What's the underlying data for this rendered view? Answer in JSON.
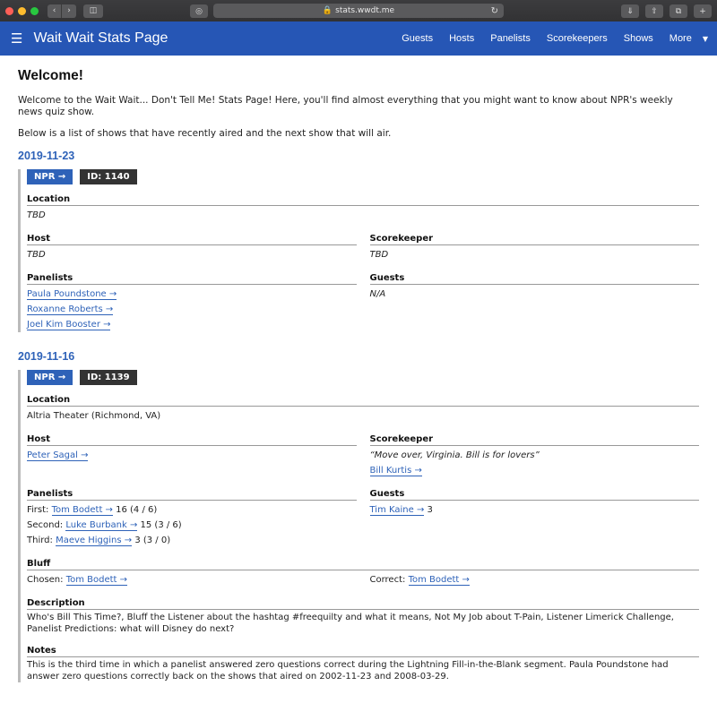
{
  "browser": {
    "url": "stats.wwdt.me"
  },
  "nav": {
    "brand": "Wait Wait Stats Page",
    "links": [
      "Guests",
      "Hosts",
      "Panelists",
      "Scorekeepers",
      "Shows",
      "More"
    ]
  },
  "page": {
    "title": "Welcome!",
    "intro1": "Welcome to the Wait Wait... Don't Tell Me! Stats Page! Here, you'll find almost everything that you might want to know about NPR's weekly news quiz show.",
    "intro2": "Below is a list of shows that have recently aired and the next show that will air."
  },
  "labels": {
    "location": "Location",
    "host": "Host",
    "scorekeeper": "Scorekeeper",
    "panelists": "Panelists",
    "guests": "Guests",
    "bluff": "Bluff",
    "description": "Description",
    "notes": "Notes",
    "chosen": "Chosen:",
    "correct": "Correct:",
    "first": "First:",
    "second": "Second:",
    "third": "Third:"
  },
  "show1": {
    "date": "2019-11-23",
    "npr": "NPR →",
    "id": "ID: 1140",
    "location": "TBD",
    "host": "TBD",
    "scorekeeper": "TBD",
    "panelists": [
      "Paula Poundstone →",
      "Roxanne Roberts →",
      "Joel Kim Booster →"
    ],
    "guests": "N/A"
  },
  "show2": {
    "date": "2019-11-16",
    "npr": "NPR →",
    "id": "ID: 1139",
    "location": "Altria Theater (Richmond, VA)",
    "host": "Peter Sagal →",
    "scorekeeper_quote": "“Move over, Virginia. Bill is for lovers”",
    "scorekeeper": "Bill Kurtis →",
    "panelists": [
      {
        "name": "Tom Bodett →",
        "score": "16 (4 / 6)"
      },
      {
        "name": "Luke Burbank →",
        "score": "15 (3 / 6)"
      },
      {
        "name": "Maeve Higgins →",
        "score": "3 (3 / 0)"
      }
    ],
    "guest": "Tim Kaine →",
    "guest_score": "3",
    "bluff_chosen": "Tom Bodett →",
    "bluff_correct": "Tom Bodett →",
    "description": "Who's Bill This Time?, Bluff the Listener about the hashtag #freequilty and what it means, Not My Job about T-Pain, Listener Limerick Challenge, Panelist Predictions: what will Disney do next?",
    "notes": "This is the third time in which a panelist answered zero questions correct during the Lightning Fill-in-the-Blank segment. Paula Poundstone had answer zero questions correctly back on the shows that aired on 2002-11-23 and 2008-03-29."
  },
  "colors": {
    "navbar": "#2656b5",
    "accent": "#2e62b8",
    "id_badge": "#333333"
  }
}
